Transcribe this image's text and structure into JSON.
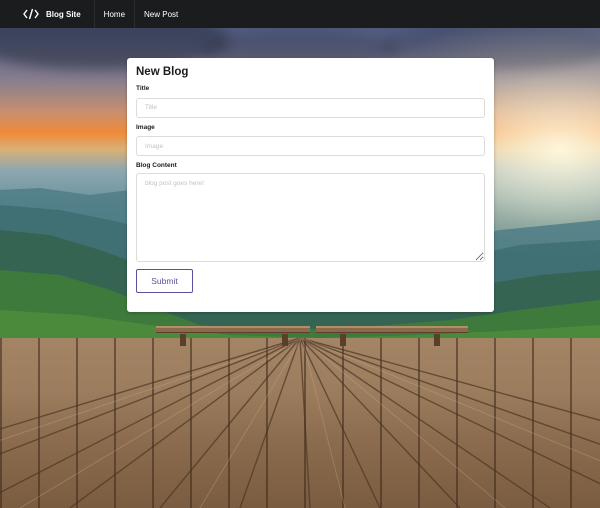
{
  "navbar": {
    "brand_icon": "code-icon",
    "brand_label": "Blog Site",
    "items": [
      {
        "label": "Home"
      },
      {
        "label": "New Post"
      }
    ]
  },
  "form": {
    "title": "New Blog",
    "fields": {
      "title": {
        "label": "Title",
        "placeholder": "Title",
        "value": ""
      },
      "image": {
        "label": "Image",
        "placeholder": "Image",
        "value": ""
      },
      "content": {
        "label": "Blog Content",
        "placeholder": "blog post goes here!",
        "value": ""
      }
    },
    "submit_label": "Submit"
  },
  "colors": {
    "navbar_bg": "#1b1c1d",
    "accent": "#5b50a0"
  }
}
